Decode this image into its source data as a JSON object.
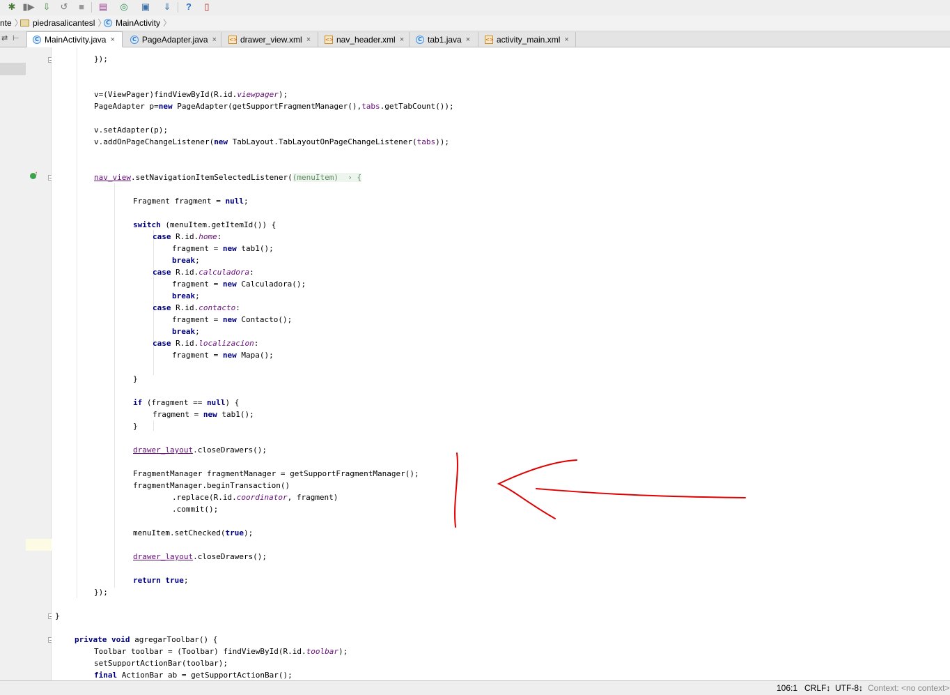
{
  "breadcrumb": [
    {
      "label": "nte",
      "icon": "none"
    },
    {
      "label": "piedrasalicantesl",
      "icon": "folder-icon"
    },
    {
      "label": "MainActivity",
      "icon": "class-icon"
    }
  ],
  "tabs": [
    {
      "label": "MainActivity.java",
      "icon": "class-icon",
      "active": true
    },
    {
      "label": "PageAdapter.java",
      "icon": "class-icon",
      "active": false
    },
    {
      "label": "drawer_view.xml",
      "icon": "xml-icon",
      "active": false
    },
    {
      "label": "nav_header.xml",
      "icon": "xml-icon",
      "active": false
    },
    {
      "label": "tab1.java",
      "icon": "class-icon",
      "active": false
    },
    {
      "label": "activity_main.xml",
      "icon": "xml-icon",
      "active": false
    }
  ],
  "tab_close_glyph": "×",
  "code": {
    "l01": "});",
    "l02a": "v=(ViewPager)findViewById(R.id.",
    "l02b": "viewpager",
    "l02c": ");",
    "l03a": "PageAdapter p=",
    "l03b": "new",
    "l03c": " PageAdapter(getSupportFragmentManager(),",
    "l03d": "tabs",
    "l03e": ".getTabCount());",
    "l04": "v.setAdapter(p);",
    "l05a": "v.addOnPageChangeListener(",
    "l05b": "new",
    "l05c": " TabLayout.TabLayoutOnPageChangeListener(",
    "l05d": "tabs",
    "l05e": "));",
    "l06a": "nav_view",
    "l06b": ".setNavigationItemSelectedListener(",
    "l06c": "(menuItem)  › {",
    "l07a": "Fragment fragment = ",
    "l07b": "null",
    "l07c": ";",
    "l08a": "switch",
    "l08b": " (menuItem.getItemId()) {",
    "l09a": "case",
    "l09b": " R.id.",
    "l09c": "home",
    "l09d": ":",
    "l10a": "fragment = ",
    "l10b": "new",
    "l10c": " tab1();",
    "l11a": "break",
    "l11b": ";",
    "l12a": "case",
    "l12b": " R.id.",
    "l12c": "calculadora",
    "l12d": ":",
    "l13a": "fragment = ",
    "l13b": "new",
    "l13c": " Calculadora();",
    "l14a": "break",
    "l14b": ";",
    "l15a": "case",
    "l15b": " R.id.",
    "l15c": "contacto",
    "l15d": ":",
    "l16a": "fragment = ",
    "l16b": "new",
    "l16c": " Contacto();",
    "l17a": "break",
    "l17b": ";",
    "l18a": "case",
    "l18b": " R.id.",
    "l18c": "localizacion",
    "l18d": ":",
    "l19a": "fragment = ",
    "l19b": "new",
    "l19c": " Mapa();",
    "l20": "}",
    "l21a": "if",
    "l21b": " (fragment == ",
    "l21c": "null",
    "l21d": ") {",
    "l22a": "fragment = ",
    "l22b": "new",
    "l22c": " tab1();",
    "l23": "}",
    "l24a": "drawer_layout",
    "l24b": ".closeDrawers();",
    "l25": "FragmentManager fragmentManager = getSupportFragmentManager();",
    "l26": "fragmentManager.beginTransaction()",
    "l27a": ".replace(R.id.",
    "l27b": "coordinator",
    "l27c": ", fragment)",
    "l28": ".commit();",
    "l29a": "menuItem.setChecked(",
    "l29b": "true",
    "l29c": ");",
    "l30a": "drawer_layout",
    "l30b": ".closeDrawers();",
    "l31a": "return true",
    "l31b": ";",
    "l32": "});",
    "l33": "}",
    "l34a": "private void",
    "l34b": " agregarToolbar() {",
    "l35a": "Toolbar toolbar = (Toolbar) findViewById(R.id.",
    "l35b": "toolbar",
    "l35c": ");",
    "l36": "setSupportActionBar(toolbar);",
    "l37a": "final",
    "l37b": " ActionBar ab = getSupportActionBar();"
  },
  "status": {
    "position": "106:1",
    "line_separator": "CRLF↕",
    "encoding": "UTF-8↕",
    "context": "Context: <no context>"
  },
  "colors": {
    "keyword": "#000080",
    "field": "#660e7a",
    "annotation_stroke": "#e00000",
    "caret_row": "#fdfbe4"
  },
  "icons": [
    "debug-icon",
    "run-coverage-icon",
    "profile-icon",
    "attach-icon",
    "stop-icon",
    "avd-manager-icon",
    "sync-icon",
    "project-structure-icon",
    "sdk-manager-icon",
    "help-icon",
    "android-device-monitor-icon",
    "lightbulb-icon",
    "override-gutter-icon",
    "fold-icon"
  ]
}
